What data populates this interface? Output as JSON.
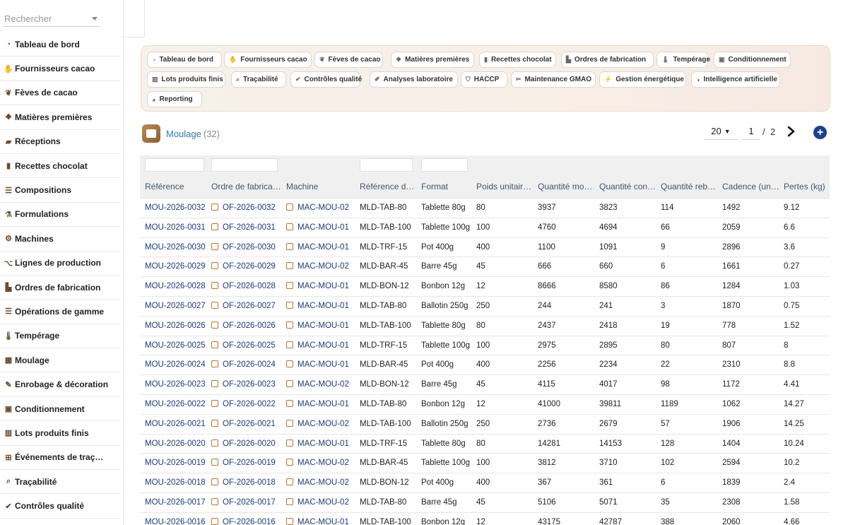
{
  "sidebar": {
    "search_placeholder": "Rechercher",
    "items": [
      {
        "label": "Tableau de bord",
        "icon": "gauge-icon"
      },
      {
        "label": "Fournisseurs cacao",
        "icon": "handshake-icon"
      },
      {
        "label": "Fèves de cacao",
        "icon": "seedling-icon"
      },
      {
        "label": "Matières premières",
        "icon": "cubes-icon"
      },
      {
        "label": "Réceptions",
        "icon": "truck-loading-icon"
      },
      {
        "label": "Recettes chocolat",
        "icon": "book-icon"
      },
      {
        "label": "Compositions",
        "icon": "list-icon"
      },
      {
        "label": "Formulations",
        "icon": "flask-icon"
      },
      {
        "label": "Machines",
        "icon": "cogs-icon"
      },
      {
        "label": "Lignes de production",
        "icon": "project-diagram-icon"
      },
      {
        "label": "Ordres de fabrication",
        "icon": "industry-icon"
      },
      {
        "label": "Opérations de gamme",
        "icon": "list-ol-icon"
      },
      {
        "label": "Tempérage",
        "icon": "thermometer-icon"
      },
      {
        "label": "Moulage",
        "icon": "th-large-icon"
      },
      {
        "label": "Enrobage & décoration",
        "icon": "paint-brush-icon"
      },
      {
        "label": "Conditionnement",
        "icon": "box-icon"
      },
      {
        "label": "Lots produits finis",
        "icon": "barcode-icon"
      },
      {
        "label": "Événements de traç…",
        "icon": "sitemap-icon"
      },
      {
        "label": "Traçabilité",
        "icon": "search-icon"
      },
      {
        "label": "Contrôles qualité",
        "icon": "clipboard-check-icon"
      }
    ]
  },
  "nav": {
    "chips": [
      {
        "label": "Tableau de bord",
        "icon": "gauge-icon"
      },
      {
        "label": "Fournisseurs cacao",
        "icon": "handshake-icon"
      },
      {
        "label": "Fèves de cacao",
        "icon": "seedling-icon"
      },
      {
        "label": "Matières premières",
        "icon": "cubes-icon"
      },
      {
        "label": "Recettes chocolat",
        "icon": "book-icon"
      },
      {
        "label": "Ordres de fabrication",
        "icon": "industry-icon"
      },
      {
        "label": "Tempérage",
        "icon": "thermometer-icon"
      },
      {
        "label": "Conditionnement",
        "icon": "box-icon"
      },
      {
        "label": "Lots produits finis",
        "icon": "barcode-icon"
      },
      {
        "label": "Traçabilité",
        "icon": "search-icon"
      },
      {
        "label": "Contrôles qualité",
        "icon": "clipboard-check-icon"
      },
      {
        "label": "Analyses laboratoire",
        "icon": "microscope-icon"
      },
      {
        "label": "HACCP",
        "icon": "shield-icon"
      },
      {
        "label": "Maintenance GMAO",
        "icon": "tools-icon"
      },
      {
        "label": "Gestion énergétique",
        "icon": "bolt-icon"
      },
      {
        "label": "Intelligence artificielle",
        "icon": "brain-icon"
      },
      {
        "label": "Reporting",
        "icon": "chart-pie-icon"
      }
    ]
  },
  "header": {
    "title": "Moulage",
    "count": "(32)",
    "per_page": "20",
    "page_current": "1",
    "page_separator": "/",
    "page_total": "2",
    "accent_color": "#2b7ba0"
  },
  "table": {
    "columns": [
      "Référence",
      "Ordre de fabrica…",
      "Machine",
      "Référence d…",
      "Format",
      "Poids unitair…",
      "Quantité mo…",
      "Quantité con…",
      "Quantité reb…",
      "Cadence (un…",
      "Pertes (kg)"
    ],
    "rows": [
      [
        "MOU-2026-0032",
        "OF-2026-0032",
        "MAC-MOU-02",
        "MLD-TAB-80",
        "Tablette 80g",
        "80",
        "3937",
        "3823",
        "114",
        "1492",
        "9.12"
      ],
      [
        "MOU-2026-0031",
        "OF-2026-0031",
        "MAC-MOU-01",
        "MLD-TAB-100",
        "Tablette 100g",
        "100",
        "4760",
        "4694",
        "66",
        "2059",
        "6.6"
      ],
      [
        "MOU-2026-0030",
        "OF-2026-0030",
        "MAC-MOU-01",
        "MLD-TRF-15",
        "Pot 400g",
        "400",
        "1100",
        "1091",
        "9",
        "2896",
        "3.6"
      ],
      [
        "MOU-2026-0029",
        "OF-2026-0029",
        "MAC-MOU-02",
        "MLD-BAR-45",
        "Barre 45g",
        "45",
        "666",
        "660",
        "6",
        "1661",
        "0.27"
      ],
      [
        "MOU-2026-0028",
        "OF-2026-0028",
        "MAC-MOU-01",
        "MLD-BON-12",
        "Bonbon 12g",
        "12",
        "8666",
        "8580",
        "86",
        "1284",
        "1.03"
      ],
      [
        "MOU-2026-0027",
        "OF-2026-0027",
        "MAC-MOU-01",
        "MLD-TAB-80",
        "Ballotin 250g",
        "250",
        "244",
        "241",
        "3",
        "1870",
        "0.75"
      ],
      [
        "MOU-2026-0026",
        "OF-2026-0026",
        "MAC-MOU-01",
        "MLD-TAB-100",
        "Tablette 80g",
        "80",
        "2437",
        "2418",
        "19",
        "778",
        "1.52"
      ],
      [
        "MOU-2026-0025",
        "OF-2026-0025",
        "MAC-MOU-01",
        "MLD-TRF-15",
        "Tablette 100g",
        "100",
        "2975",
        "2895",
        "80",
        "807",
        "8"
      ],
      [
        "MOU-2026-0024",
        "OF-2026-0024",
        "MAC-MOU-01",
        "MLD-BAR-45",
        "Pot 400g",
        "400",
        "2256",
        "2234",
        "22",
        "2310",
        "8.8"
      ],
      [
        "MOU-2026-0023",
        "OF-2026-0023",
        "MAC-MOU-02",
        "MLD-BON-12",
        "Barre 45g",
        "45",
        "4115",
        "4017",
        "98",
        "1172",
        "4.41"
      ],
      [
        "MOU-2026-0022",
        "OF-2026-0022",
        "MAC-MOU-01",
        "MLD-TAB-80",
        "Bonbon 12g",
        "12",
        "41000",
        "39811",
        "1189",
        "1062",
        "14.27"
      ],
      [
        "MOU-2026-0021",
        "OF-2026-0021",
        "MAC-MOU-02",
        "MLD-TAB-100",
        "Ballotin 250g",
        "250",
        "2736",
        "2679",
        "57",
        "1906",
        "14.25"
      ],
      [
        "MOU-2026-0020",
        "OF-2026-0020",
        "MAC-MOU-01",
        "MLD-TRF-15",
        "Tablette 80g",
        "80",
        "14281",
        "14153",
        "128",
        "1404",
        "10.24"
      ],
      [
        "MOU-2026-0019",
        "OF-2026-0019",
        "MAC-MOU-02",
        "MLD-BAR-45",
        "Tablette 100g",
        "100",
        "3812",
        "3710",
        "102",
        "2594",
        "10.2"
      ],
      [
        "MOU-2026-0018",
        "OF-2026-0018",
        "MAC-MOU-02",
        "MLD-BON-12",
        "Pot 400g",
        "400",
        "367",
        "361",
        "6",
        "1839",
        "2.4"
      ],
      [
        "MOU-2026-0017",
        "OF-2026-0017",
        "MAC-MOU-02",
        "MLD-TAB-80",
        "Barre 45g",
        "45",
        "5106",
        "5071",
        "35",
        "2308",
        "1.58"
      ],
      [
        "MOU-2026-0016",
        "OF-2026-0016",
        "MAC-MOU-01",
        "MLD-TAB-100",
        "Bonbon 12g",
        "12",
        "43175",
        "42787",
        "388",
        "2060",
        "4.66"
      ]
    ]
  }
}
